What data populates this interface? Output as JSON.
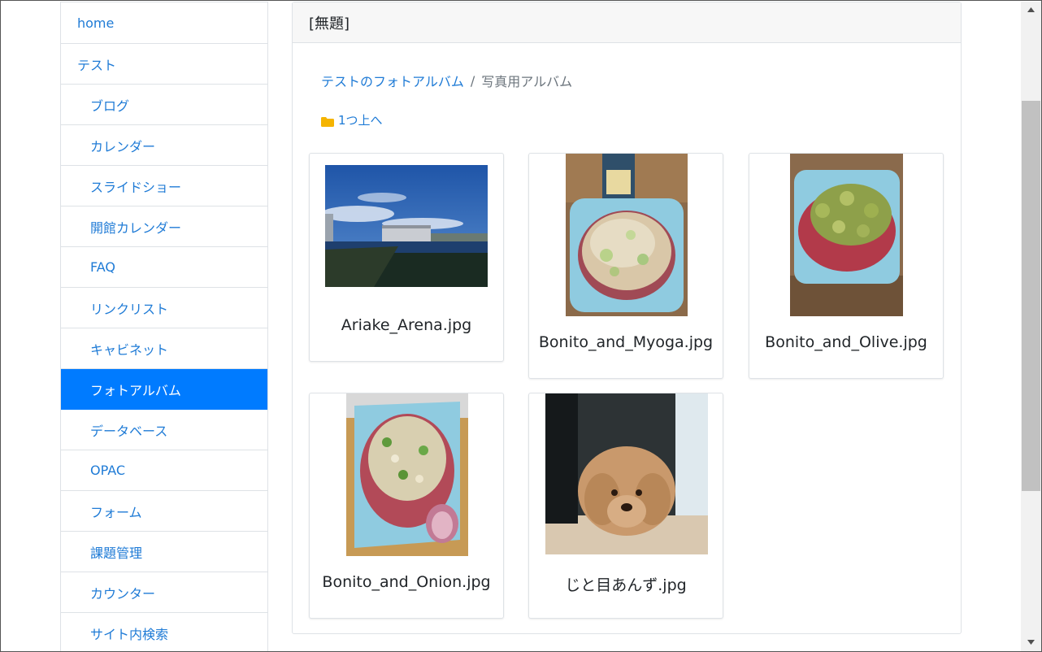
{
  "sidebar": {
    "items": [
      {
        "label": "home"
      },
      {
        "label": "テスト"
      },
      {
        "label": "ブログ"
      },
      {
        "label": "カレンダー"
      },
      {
        "label": "スライドショー"
      },
      {
        "label": "開館カレンダー"
      },
      {
        "label": "FAQ"
      },
      {
        "label": "リンクリスト"
      },
      {
        "label": "キャビネット"
      },
      {
        "label": "フォトアルバム"
      },
      {
        "label": "データベース"
      },
      {
        "label": "OPAC"
      },
      {
        "label": "フォーム"
      },
      {
        "label": "課題管理"
      },
      {
        "label": "カウンター"
      },
      {
        "label": "サイト内検索"
      }
    ]
  },
  "panel": {
    "title": "[無題]",
    "breadcrumb": {
      "parent": "テストのフォトアルバム",
      "separator": "/",
      "current": "写真用アルバム"
    },
    "up_link": "1つ上へ"
  },
  "photos": [
    {
      "caption": "Ariake_Arena.jpg"
    },
    {
      "caption": "Bonito_and_Myoga.jpg"
    },
    {
      "caption": "Bonito_and_Olive.jpg"
    },
    {
      "caption": "Bonito_and_Onion.jpg"
    },
    {
      "caption": "じと目あんず.jpg"
    }
  ],
  "colors": {
    "link": "#1f7bd6",
    "active_bg": "#007bff",
    "folder": "#f5b400"
  },
  "icons": {
    "up_link": "folder-icon",
    "scroll_up": "scroll-up-arrow",
    "scroll_down": "scroll-down-arrow"
  }
}
